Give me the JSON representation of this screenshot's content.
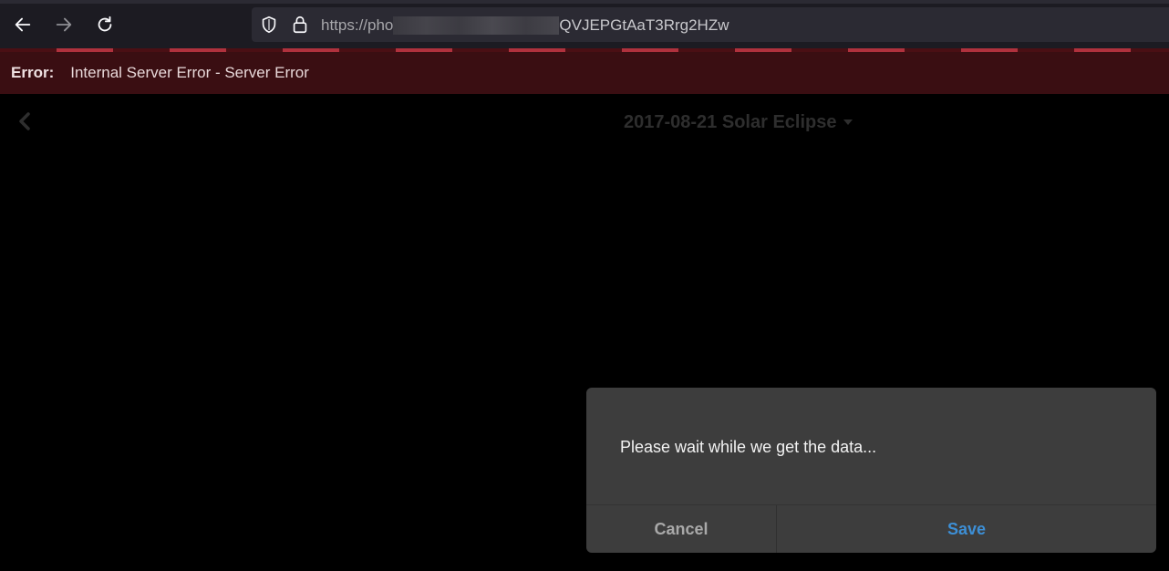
{
  "browser": {
    "url_prefix": "https://pho",
    "url_suffix": "QVJEPGtAaT3Rrg2HZw",
    "icons": {
      "back": "arrow-left-icon",
      "forward": "arrow-right-icon",
      "reload": "reload-icon",
      "shield": "shield-icon",
      "lock": "lock-icon"
    }
  },
  "error": {
    "label": "Error:",
    "message": "Internal Server Error - Server Error"
  },
  "header": {
    "title": "2017-08-21 Solar Eclipse"
  },
  "dialog": {
    "message": "Please wait while we get the data...",
    "cancel_label": "Cancel",
    "save_label": "Save"
  },
  "colors": {
    "error_bar": "#3a0e12",
    "accent": "#3d8fd6",
    "dialog_bg": "#3d3d3d"
  }
}
